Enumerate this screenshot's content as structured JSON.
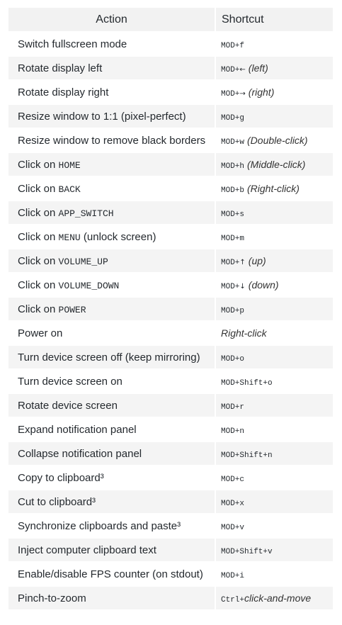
{
  "header": {
    "action": "Action",
    "shortcut": "Shortcut"
  },
  "rows": [
    {
      "action_text": "Switch fullscreen mode",
      "action_code": "",
      "action_suffix": "",
      "shortcut_mod": "MOD+f",
      "shortcut_arrow": "",
      "shortcut_extra": "",
      "shortcut_note": ""
    },
    {
      "action_text": "Rotate display left",
      "action_code": "",
      "action_suffix": "",
      "shortcut_mod": "MOD+",
      "shortcut_arrow": "←",
      "shortcut_extra": "",
      "shortcut_note": "(left)"
    },
    {
      "action_text": "Rotate display right",
      "action_code": "",
      "action_suffix": "",
      "shortcut_mod": "MOD+",
      "shortcut_arrow": "→",
      "shortcut_extra": "",
      "shortcut_note": "(right)"
    },
    {
      "action_text": "Resize window to 1:1 (pixel-perfect)",
      "action_code": "",
      "action_suffix": "",
      "shortcut_mod": "MOD+g",
      "shortcut_arrow": "",
      "shortcut_extra": "",
      "shortcut_note": ""
    },
    {
      "action_text": "Resize window to remove black borders",
      "action_code": "",
      "action_suffix": "",
      "shortcut_mod": "MOD+w",
      "shortcut_arrow": "",
      "shortcut_extra": "",
      "shortcut_note": "(Double-click)"
    },
    {
      "action_text": "Click on ",
      "action_code": "HOME",
      "action_suffix": "",
      "shortcut_mod": "MOD+h",
      "shortcut_arrow": "",
      "shortcut_extra": "",
      "shortcut_note": "(Middle-click)"
    },
    {
      "action_text": "Click on ",
      "action_code": "BACK",
      "action_suffix": "",
      "shortcut_mod": "MOD+b",
      "shortcut_arrow": "",
      "shortcut_extra": "",
      "shortcut_note": "(Right-click)"
    },
    {
      "action_text": "Click on ",
      "action_code": "APP_SWITCH",
      "action_suffix": "",
      "shortcut_mod": "MOD+s",
      "shortcut_arrow": "",
      "shortcut_extra": "",
      "shortcut_note": ""
    },
    {
      "action_text": "Click on ",
      "action_code": "MENU",
      "action_suffix": " (unlock screen)",
      "shortcut_mod": "MOD+m",
      "shortcut_arrow": "",
      "shortcut_extra": "",
      "shortcut_note": ""
    },
    {
      "action_text": "Click on ",
      "action_code": "VOLUME_UP",
      "action_suffix": "",
      "shortcut_mod": "MOD+",
      "shortcut_arrow": "↑",
      "shortcut_extra": "",
      "shortcut_note": "(up)"
    },
    {
      "action_text": "Click on ",
      "action_code": "VOLUME_DOWN",
      "action_suffix": "",
      "shortcut_mod": "MOD+",
      "shortcut_arrow": "↓",
      "shortcut_extra": "",
      "shortcut_note": "(down)"
    },
    {
      "action_text": "Click on ",
      "action_code": "POWER",
      "action_suffix": "",
      "shortcut_mod": "MOD+p",
      "shortcut_arrow": "",
      "shortcut_extra": "",
      "shortcut_note": ""
    },
    {
      "action_text": "Power on",
      "action_code": "",
      "action_suffix": "",
      "shortcut_mod": "",
      "shortcut_arrow": "",
      "shortcut_extra": "",
      "shortcut_note": "Right-click"
    },
    {
      "action_text": "Turn device screen off (keep mirroring)",
      "action_code": "",
      "action_suffix": "",
      "shortcut_mod": "MOD+o",
      "shortcut_arrow": "",
      "shortcut_extra": "",
      "shortcut_note": ""
    },
    {
      "action_text": "Turn device screen on",
      "action_code": "",
      "action_suffix": "",
      "shortcut_mod": "MOD+Shift+o",
      "shortcut_arrow": "",
      "shortcut_extra": "",
      "shortcut_note": ""
    },
    {
      "action_text": "Rotate device screen",
      "action_code": "",
      "action_suffix": "",
      "shortcut_mod": "MOD+r",
      "shortcut_arrow": "",
      "shortcut_extra": "",
      "shortcut_note": ""
    },
    {
      "action_text": "Expand notification panel",
      "action_code": "",
      "action_suffix": "",
      "shortcut_mod": "MOD+n",
      "shortcut_arrow": "",
      "shortcut_extra": "",
      "shortcut_note": ""
    },
    {
      "action_text": "Collapse notification panel",
      "action_code": "",
      "action_suffix": "",
      "shortcut_mod": "MOD+Shift+n",
      "shortcut_arrow": "",
      "shortcut_extra": "",
      "shortcut_note": ""
    },
    {
      "action_text": "Copy to clipboard³",
      "action_code": "",
      "action_suffix": "",
      "shortcut_mod": "MOD+c",
      "shortcut_arrow": "",
      "shortcut_extra": "",
      "shortcut_note": ""
    },
    {
      "action_text": "Cut to clipboard³",
      "action_code": "",
      "action_suffix": "",
      "shortcut_mod": "MOD+x",
      "shortcut_arrow": "",
      "shortcut_extra": "",
      "shortcut_note": ""
    },
    {
      "action_text": "Synchronize clipboards and paste³",
      "action_code": "",
      "action_suffix": "",
      "shortcut_mod": "MOD+v",
      "shortcut_arrow": "",
      "shortcut_extra": "",
      "shortcut_note": ""
    },
    {
      "action_text": "Inject computer clipboard text",
      "action_code": "",
      "action_suffix": "",
      "shortcut_mod": "MOD+Shift+v",
      "shortcut_arrow": "",
      "shortcut_extra": "",
      "shortcut_note": ""
    },
    {
      "action_text": "Enable/disable FPS counter (on stdout)",
      "action_code": "",
      "action_suffix": "",
      "shortcut_mod": "MOD+i",
      "shortcut_arrow": "",
      "shortcut_extra": "",
      "shortcut_note": ""
    },
    {
      "action_text": "Pinch-to-zoom",
      "action_code": "",
      "action_suffix": "",
      "shortcut_mod": "Ctrl+",
      "shortcut_arrow": "",
      "shortcut_extra": "",
      "shortcut_note": "click-and-move"
    }
  ]
}
